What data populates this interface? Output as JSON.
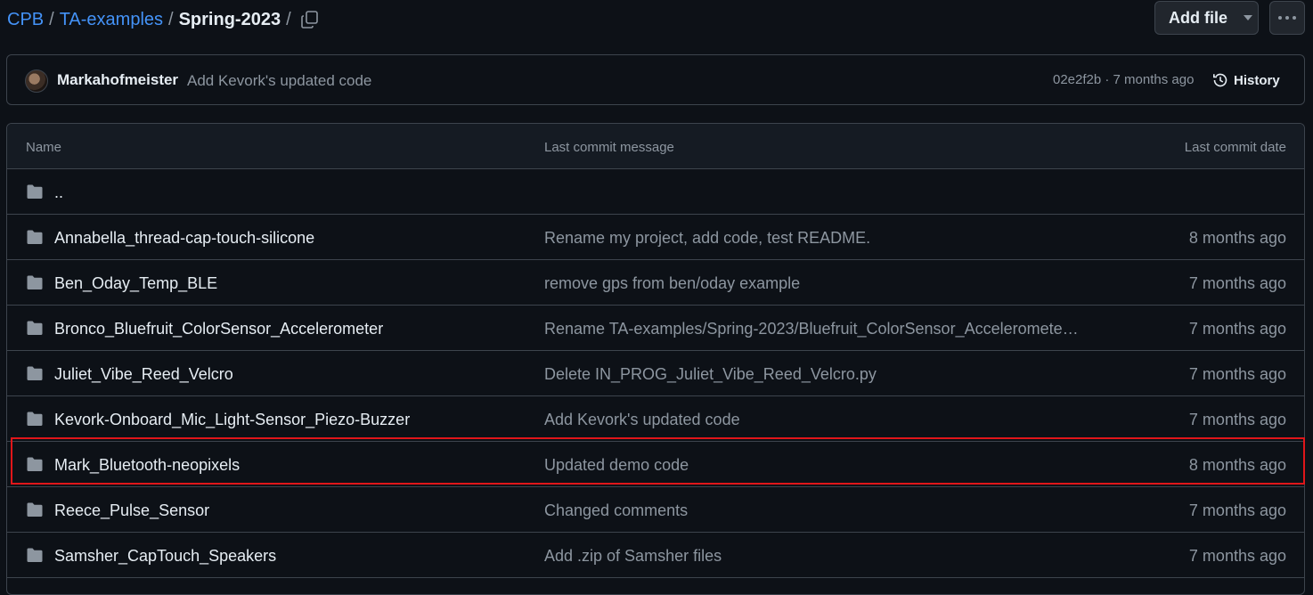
{
  "breadcrumb": {
    "items": [
      "CPB",
      "TA-examples"
    ],
    "separator": "/",
    "current": "Spring-2023",
    "trailing_separator": "/"
  },
  "toolbar": {
    "add_file_label": "Add file",
    "more_icon": "kebab-horizontal-icon",
    "copy_icon": "copy-icon"
  },
  "latest_commit": {
    "author": "Markahofmeister",
    "message": "Add Kevork's updated code",
    "meta": "02e2f2b · 7 months ago",
    "history_label": "History"
  },
  "table": {
    "headers": {
      "name": "Name",
      "message": "Last commit message",
      "date": "Last commit date"
    },
    "parent_row": "..",
    "rows": [
      {
        "name": "Annabella_thread-cap-touch-silicone",
        "message": "Rename my project, add code, test README.",
        "date": "8 months ago"
      },
      {
        "name": "Ben_Oday_Temp_BLE",
        "message": "remove gps from ben/oday example",
        "date": "7 months ago"
      },
      {
        "name": "Bronco_Bluefruit_ColorSensor_Accelerometer",
        "message": "Rename TA-examples/Spring-2023/Bluefruit_ColorSensor_Accelerometer.py…",
        "date": "7 months ago"
      },
      {
        "name": "Juliet_Vibe_Reed_Velcro",
        "message": "Delete IN_PROG_Juliet_Vibe_Reed_Velcro.py",
        "date": "7 months ago"
      },
      {
        "name": "Kevork-Onboard_Mic_Light-Sensor_Piezo-Buzzer",
        "message": "Add Kevork's updated code",
        "date": "7 months ago"
      },
      {
        "name": "Mark_Bluetooth-neopixels",
        "message": "Updated demo code",
        "date": "8 months ago"
      },
      {
        "name": "Reece_Pulse_Sensor",
        "message": "Changed comments",
        "date": "7 months ago"
      },
      {
        "name": "Samsher_CapTouch_Speakers",
        "message": "Add .zip of Samsher files",
        "date": "7 months ago"
      }
    ]
  },
  "colors": {
    "background": "#0d1117",
    "link": "#4493f8",
    "muted": "#8d96a0",
    "border": "#3d444d",
    "highlight": "#e0161a"
  }
}
